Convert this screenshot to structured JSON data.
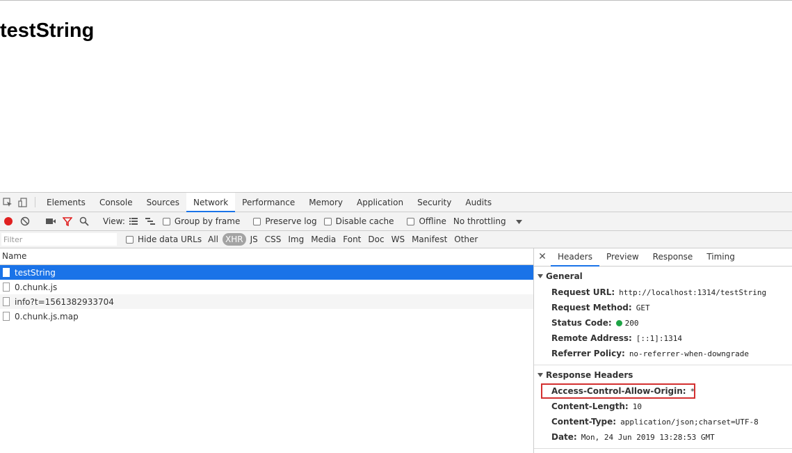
{
  "page": {
    "heading": "testString"
  },
  "devtools": {
    "tabs": [
      "Elements",
      "Console",
      "Sources",
      "Network",
      "Performance",
      "Memory",
      "Application",
      "Security",
      "Audits"
    ],
    "active_tab": "Network",
    "toolbar": {
      "view_label": "View:",
      "group_by_frame": "Group by frame",
      "preserve_log": "Preserve log",
      "disable_cache": "Disable cache",
      "offline": "Offline",
      "throttling": "No throttling"
    },
    "filter": {
      "placeholder": "Filter",
      "hide_data_urls": "Hide data URLs",
      "types": [
        "All",
        "XHR",
        "JS",
        "CSS",
        "Img",
        "Media",
        "Font",
        "Doc",
        "WS",
        "Manifest",
        "Other"
      ],
      "selected_type": "XHR"
    },
    "requests": {
      "header": "Name",
      "rows": [
        "testString",
        "0.chunk.js",
        "info?t=1561382933704",
        "0.chunk.js.map"
      ]
    },
    "detail": {
      "tabs": [
        "Headers",
        "Preview",
        "Response",
        "Timing"
      ],
      "general": {
        "title": "General",
        "request_url_key": "Request URL:",
        "request_url": "http://localhost:1314/testString",
        "request_method_key": "Request Method:",
        "request_method": "GET",
        "status_code_key": "Status Code:",
        "status_code": "200",
        "remote_address_key": "Remote Address:",
        "remote_address": "[::1]:1314",
        "referrer_policy_key": "Referrer Policy:",
        "referrer_policy": "no-referrer-when-downgrade"
      },
      "response_headers": {
        "title": "Response Headers",
        "acao_key": "Access-Control-Allow-Origin:",
        "acao": "*",
        "content_length_key": "Content-Length:",
        "content_length": "10",
        "content_type_key": "Content-Type:",
        "content_type": "application/json;charset=UTF-8",
        "date_key": "Date:",
        "date": "Mon, 24 Jun 2019 13:28:53 GMT"
      }
    }
  }
}
